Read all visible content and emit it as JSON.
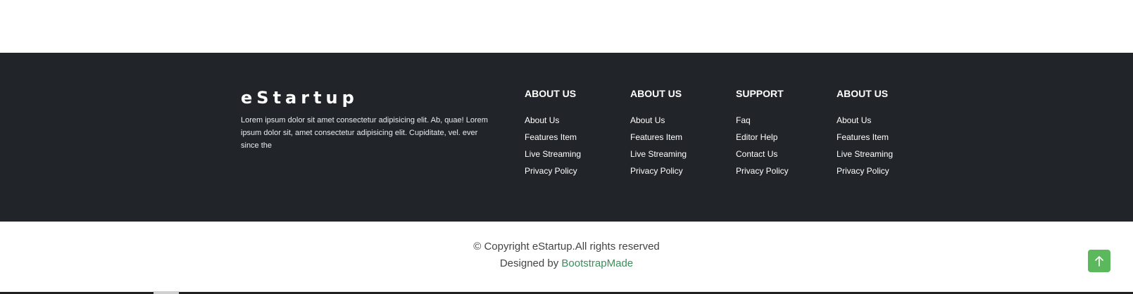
{
  "footer": {
    "brand": "eStartup",
    "about_text": "Lorem ipsum dolor sit amet consectetur adipisicing elit. Ab, quae! Lorem ipsum dolor sit, amet consectetur adipisicing elit. Cupiditate, vel. ever since the",
    "columns": [
      {
        "title": "ABOUT US",
        "links": [
          "About Us",
          "Features Item",
          "Live Streaming",
          "Privacy Policy"
        ]
      },
      {
        "title": "ABOUT US",
        "links": [
          "About Us",
          "Features Item",
          "Live Streaming",
          "Privacy Policy"
        ]
      },
      {
        "title": "SUPPORT",
        "links": [
          "Faq",
          "Editor Help",
          "Contact Us",
          "Privacy Policy"
        ]
      },
      {
        "title": "ABOUT US",
        "links": [
          "About Us",
          "Features Item",
          "Live Streaming",
          "Privacy Policy"
        ]
      }
    ]
  },
  "bottom": {
    "copyright": "© Copyright eStartup.All rights reserved",
    "designed_by_prefix": "Designed by ",
    "designed_by_link": "BootstrapMade"
  },
  "back_to_top": {
    "icon": "arrow-up-icon"
  },
  "colors": {
    "footer_bg": "#212529",
    "accent_green": "#5cb85c",
    "link_green": "#3c8d5a"
  }
}
